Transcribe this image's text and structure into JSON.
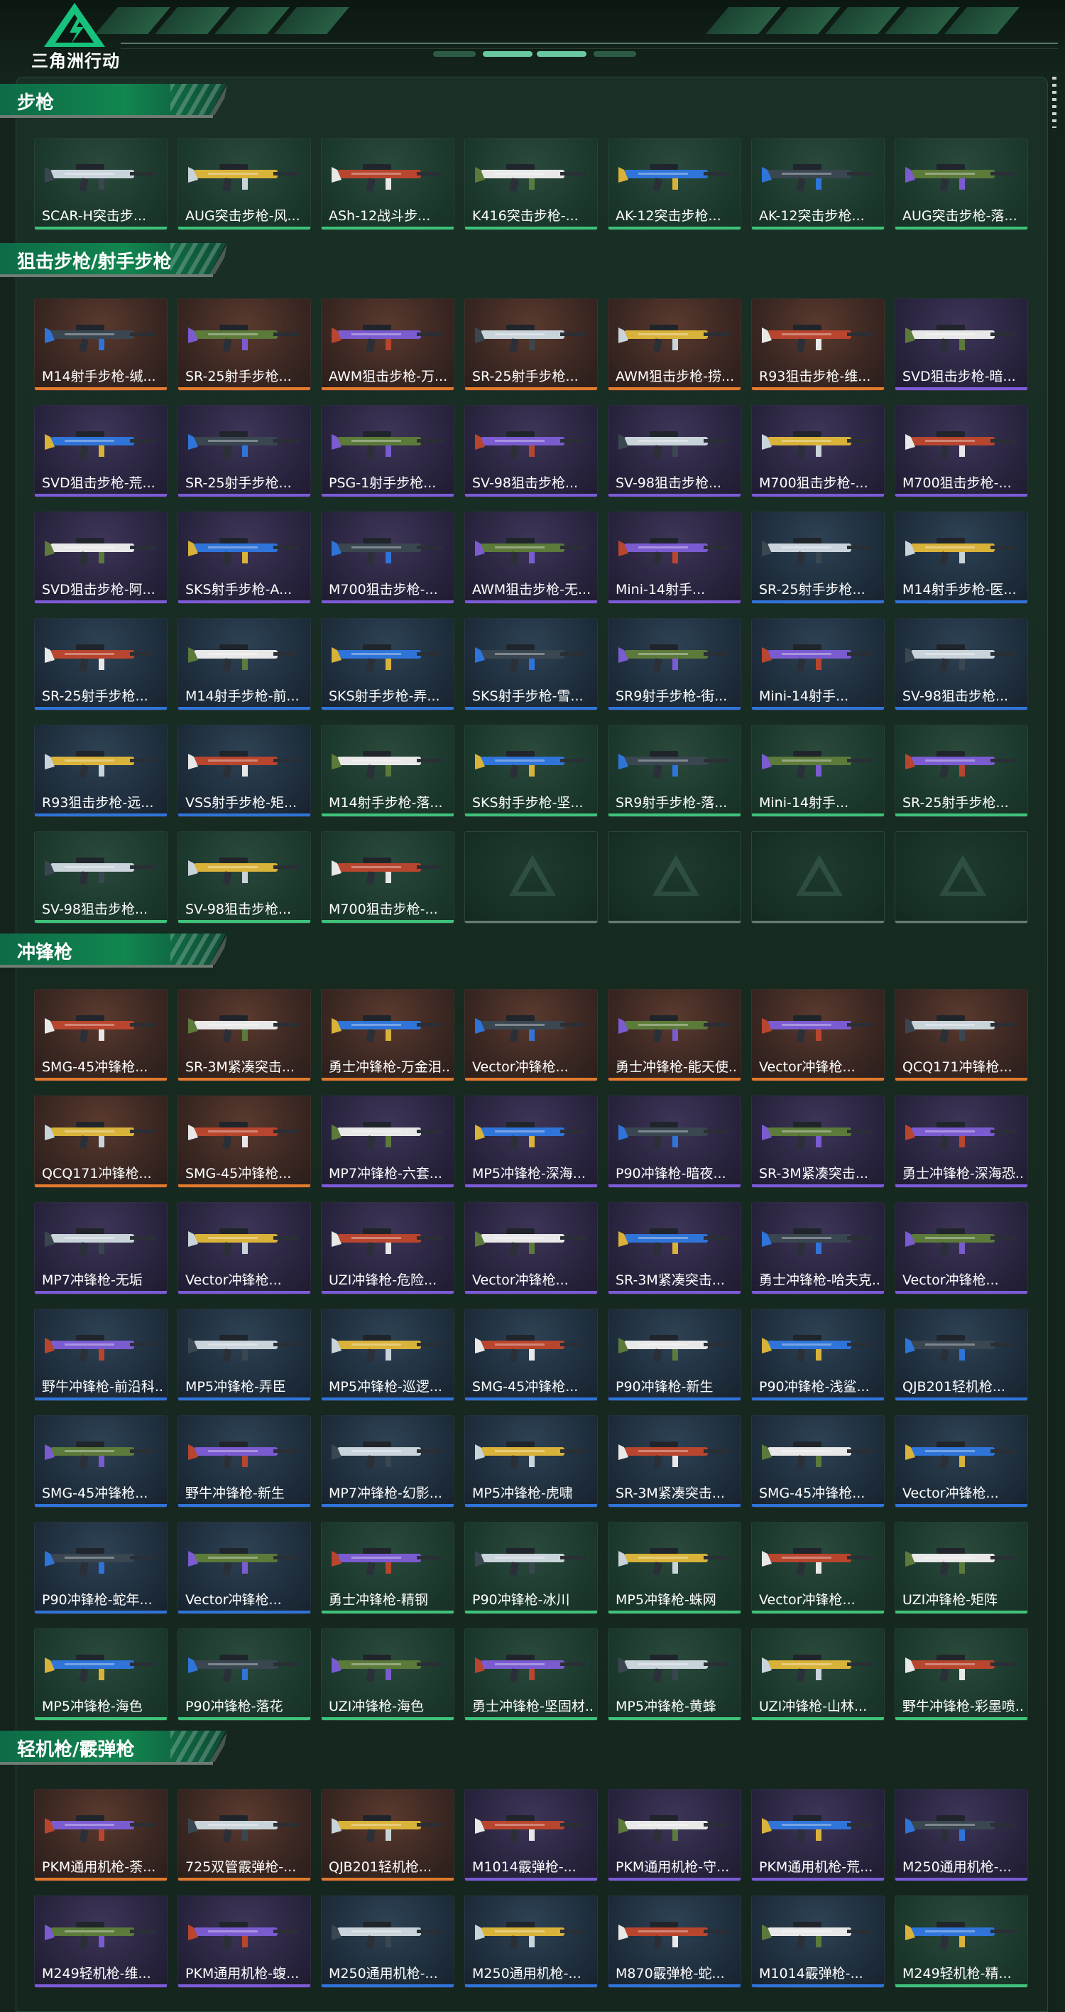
{
  "header": {
    "logo_text": "三角洲行动",
    "logo_icon": "delta-logo-icon"
  },
  "colors": {
    "orange": "#e07a2c",
    "purple": "#7b5bd6",
    "blue": "#2f74d8",
    "green": "#3ec27a",
    "accent": "#12864f"
  },
  "sections": [
    {
      "title": "步枪",
      "items": [
        {
          "label": "SCAR-H突击步...",
          "rarity": "green"
        },
        {
          "label": "AUG突击步枪-风...",
          "rarity": "green"
        },
        {
          "label": "ASh-12战斗步...",
          "rarity": "green"
        },
        {
          "label": "K416突击步枪-...",
          "rarity": "green"
        },
        {
          "label": "AK-12突击步枪...",
          "rarity": "green"
        },
        {
          "label": "AK-12突击步枪...",
          "rarity": "green"
        },
        {
          "label": "AUG突击步枪-落...",
          "rarity": "green"
        }
      ]
    },
    {
      "title": "狙击步枪/射手步枪",
      "items": [
        {
          "label": "M14射手步枪-缄...",
          "rarity": "orange"
        },
        {
          "label": "SR-25射手步枪...",
          "rarity": "orange"
        },
        {
          "label": "AWM狙击步枪-万...",
          "rarity": "orange"
        },
        {
          "label": "SR-25射手步枪...",
          "rarity": "orange"
        },
        {
          "label": "AWM狙击步枪-捞...",
          "rarity": "orange"
        },
        {
          "label": "R93狙击步枪-维...",
          "rarity": "orange"
        },
        {
          "label": "SVD狙击步枪-暗...",
          "rarity": "purple"
        },
        {
          "label": "SVD狙击步枪-荒...",
          "rarity": "purple"
        },
        {
          "label": "SR-25射手步枪...",
          "rarity": "purple"
        },
        {
          "label": "PSG-1射手步枪...",
          "rarity": "purple"
        },
        {
          "label": "SV-98狙击步枪...",
          "rarity": "purple"
        },
        {
          "label": "SV-98狙击步枪...",
          "rarity": "purple"
        },
        {
          "label": "M700狙击步枪-...",
          "rarity": "purple"
        },
        {
          "label": "M700狙击步枪-...",
          "rarity": "purple"
        },
        {
          "label": "SVD狙击步枪-阿...",
          "rarity": "purple"
        },
        {
          "label": "SKS射手步枪-A...",
          "rarity": "purple"
        },
        {
          "label": "M700狙击步枪-...",
          "rarity": "purple"
        },
        {
          "label": "AWM狙击步枪-无...",
          "rarity": "purple"
        },
        {
          "label": "Mini-14射手...",
          "rarity": "purple"
        },
        {
          "label": "SR-25射手步枪...",
          "rarity": "blue"
        },
        {
          "label": "M14射手步枪-医...",
          "rarity": "blue"
        },
        {
          "label": "SR-25射手步枪...",
          "rarity": "blue"
        },
        {
          "label": "M14射手步枪-前...",
          "rarity": "blue"
        },
        {
          "label": "SKS射手步枪-弄...",
          "rarity": "blue"
        },
        {
          "label": "SKS射手步枪-雪...",
          "rarity": "blue"
        },
        {
          "label": "SR9射手步枪-街...",
          "rarity": "blue"
        },
        {
          "label": "Mini-14射手...",
          "rarity": "blue"
        },
        {
          "label": "SV-98狙击步枪...",
          "rarity": "blue"
        },
        {
          "label": "R93狙击步枪-远...",
          "rarity": "blue"
        },
        {
          "label": "VSS射手步枪-矩...",
          "rarity": "blue"
        },
        {
          "label": "M14射手步枪-落...",
          "rarity": "green"
        },
        {
          "label": "SKS射手步枪-坚...",
          "rarity": "green"
        },
        {
          "label": "SR9射手步枪-落...",
          "rarity": "green"
        },
        {
          "label": "Mini-14射手...",
          "rarity": "green"
        },
        {
          "label": "SR-25射手步枪...",
          "rarity": "green"
        },
        {
          "label": "SV-98狙击步枪...",
          "rarity": "green"
        },
        {
          "label": "SV-98狙击步枪...",
          "rarity": "green"
        },
        {
          "label": "M700狙击步枪-...",
          "rarity": "green"
        },
        {
          "label": "",
          "rarity": "empty"
        },
        {
          "label": "",
          "rarity": "empty"
        },
        {
          "label": "",
          "rarity": "empty"
        },
        {
          "label": "",
          "rarity": "empty"
        }
      ]
    },
    {
      "title": "冲锋枪",
      "items": [
        {
          "label": "SMG-45冲锋枪...",
          "rarity": "orange"
        },
        {
          "label": "SR-3M紧凑突击...",
          "rarity": "orange"
        },
        {
          "label": "勇士冲锋枪-万金泪...",
          "rarity": "orange"
        },
        {
          "label": "Vector冲锋枪...",
          "rarity": "orange"
        },
        {
          "label": "勇士冲锋枪-能天使...",
          "rarity": "orange"
        },
        {
          "label": "Vector冲锋枪...",
          "rarity": "orange"
        },
        {
          "label": "QCQ171冲锋枪...",
          "rarity": "orange"
        },
        {
          "label": "QCQ171冲锋枪...",
          "rarity": "orange"
        },
        {
          "label": "SMG-45冲锋枪...",
          "rarity": "orange"
        },
        {
          "label": "MP7冲锋枪-六套...",
          "rarity": "purple"
        },
        {
          "label": "MP5冲锋枪-深海...",
          "rarity": "purple"
        },
        {
          "label": "P90冲锋枪-暗夜...",
          "rarity": "purple"
        },
        {
          "label": "SR-3M紧凑突击...",
          "rarity": "purple"
        },
        {
          "label": "勇士冲锋枪-深海恐...",
          "rarity": "purple"
        },
        {
          "label": "MP7冲锋枪-无垢",
          "rarity": "purple"
        },
        {
          "label": "Vector冲锋枪...",
          "rarity": "purple"
        },
        {
          "label": "UZI冲锋枪-危险...",
          "rarity": "purple"
        },
        {
          "label": "Vector冲锋枪...",
          "rarity": "purple"
        },
        {
          "label": "SR-3M紧凑突击...",
          "rarity": "purple"
        },
        {
          "label": "勇士冲锋枪-哈夫克...",
          "rarity": "purple"
        },
        {
          "label": "Vector冲锋枪...",
          "rarity": "purple"
        },
        {
          "label": "野牛冲锋枪-前沿科...",
          "rarity": "blue"
        },
        {
          "label": "MP5冲锋枪-弄臣",
          "rarity": "blue"
        },
        {
          "label": "MP5冲锋枪-巡逻...",
          "rarity": "blue"
        },
        {
          "label": "SMG-45冲锋枪...",
          "rarity": "blue"
        },
        {
          "label": "P90冲锋枪-新生",
          "rarity": "blue"
        },
        {
          "label": "P90冲锋枪-浅鲨...",
          "rarity": "blue"
        },
        {
          "label": "QJB201轻机枪...",
          "rarity": "blue"
        },
        {
          "label": "SMG-45冲锋枪...",
          "rarity": "blue"
        },
        {
          "label": "野牛冲锋枪-新生",
          "rarity": "blue"
        },
        {
          "label": "MP7冲锋枪-幻影...",
          "rarity": "blue"
        },
        {
          "label": "MP5冲锋枪-虎啸",
          "rarity": "blue"
        },
        {
          "label": "SR-3M紧凑突击...",
          "rarity": "blue"
        },
        {
          "label": "SMG-45冲锋枪...",
          "rarity": "blue"
        },
        {
          "label": "Vector冲锋枪...",
          "rarity": "blue"
        },
        {
          "label": "P90冲锋枪-蛇年...",
          "rarity": "blue"
        },
        {
          "label": "Vector冲锋枪...",
          "rarity": "blue"
        },
        {
          "label": "勇士冲锋枪-精钢",
          "rarity": "green"
        },
        {
          "label": "P90冲锋枪-冰川",
          "rarity": "green"
        },
        {
          "label": "MP5冲锋枪-蛛网",
          "rarity": "green"
        },
        {
          "label": "Vector冲锋枪...",
          "rarity": "green"
        },
        {
          "label": "UZI冲锋枪-矩阵",
          "rarity": "green"
        },
        {
          "label": "MP5冲锋枪-海色",
          "rarity": "green"
        },
        {
          "label": "P90冲锋枪-落花",
          "rarity": "green"
        },
        {
          "label": "UZI冲锋枪-海色",
          "rarity": "green"
        },
        {
          "label": "勇士冲锋枪-坚固材...",
          "rarity": "green"
        },
        {
          "label": "MP5冲锋枪-黄蜂",
          "rarity": "green"
        },
        {
          "label": "UZI冲锋枪-山林...",
          "rarity": "green"
        },
        {
          "label": "野牛冲锋枪-彩墨喷...",
          "rarity": "green"
        }
      ]
    },
    {
      "title": "轻机枪/霰弹枪",
      "items": [
        {
          "label": "PKM通用机枪-荼...",
          "rarity": "orange"
        },
        {
          "label": "725双管霰弹枪-...",
          "rarity": "orange"
        },
        {
          "label": "QJB201轻机枪...",
          "rarity": "orange"
        },
        {
          "label": "M1014霰弹枪-...",
          "rarity": "purple"
        },
        {
          "label": "PKM通用机枪-守...",
          "rarity": "purple"
        },
        {
          "label": "PKM通用机枪-荒...",
          "rarity": "purple"
        },
        {
          "label": "M250通用机枪-...",
          "rarity": "purple"
        },
        {
          "label": "M249轻机枪-维...",
          "rarity": "purple"
        },
        {
          "label": "PKM通用机枪-蝮...",
          "rarity": "purple"
        },
        {
          "label": "M250通用机枪-...",
          "rarity": "blue"
        },
        {
          "label": "M250通用机枪-...",
          "rarity": "blue"
        },
        {
          "label": "M870霰弹枪-蛇...",
          "rarity": "blue"
        },
        {
          "label": "M1014霰弹枪-...",
          "rarity": "blue"
        },
        {
          "label": "M249轻机枪-精...",
          "rarity": "green"
        }
      ]
    }
  ]
}
